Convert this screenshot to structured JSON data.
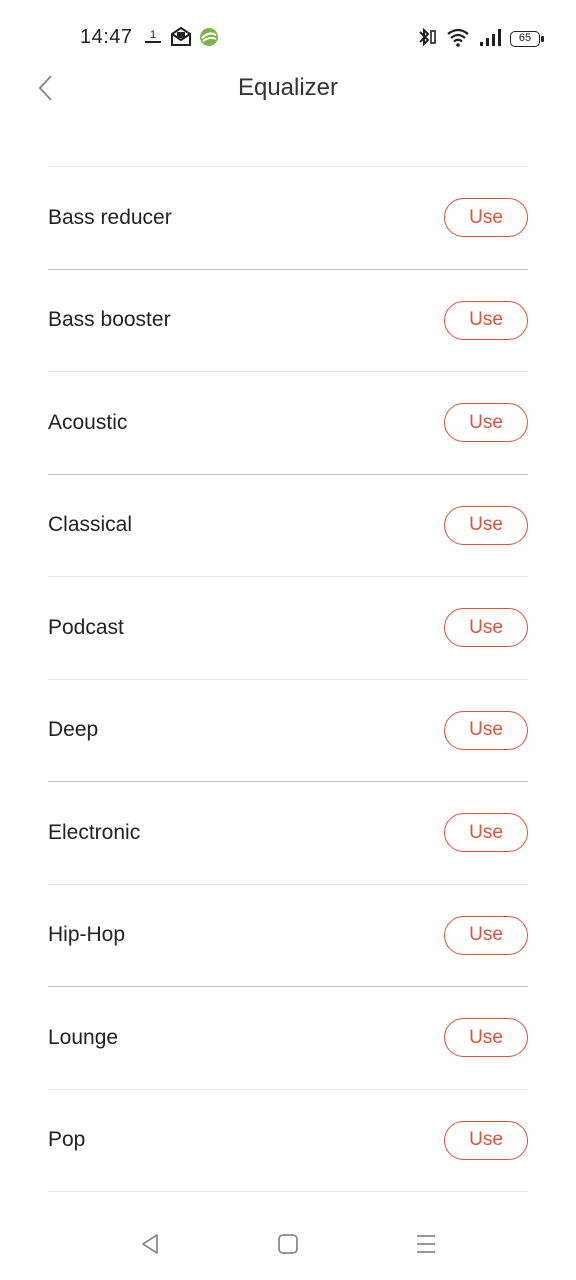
{
  "status_bar": {
    "time": "14:47",
    "battery_level": "65",
    "left_icons": [
      "notification-app-icon",
      "mail-app-icon",
      "globe-app-icon"
    ],
    "right_icons": [
      "bluetooth-icon",
      "wifi-icon",
      "signal-icon",
      "battery-icon"
    ]
  },
  "header": {
    "title": "Equalizer",
    "back_icon": "chevron-left-icon"
  },
  "presets": [
    {
      "name": "Bass reducer",
      "button": "Use"
    },
    {
      "name": "Bass booster",
      "button": "Use"
    },
    {
      "name": "Acoustic",
      "button": "Use"
    },
    {
      "name": "Classical",
      "button": "Use"
    },
    {
      "name": "Podcast",
      "button": "Use"
    },
    {
      "name": "Deep",
      "button": "Use"
    },
    {
      "name": "Electronic",
      "button": "Use"
    },
    {
      "name": "Hip-Hop",
      "button": "Use"
    },
    {
      "name": "Lounge",
      "button": "Use"
    },
    {
      "name": "Pop",
      "button": "Use"
    }
  ],
  "colors": {
    "accent": "#d9533e",
    "text": "#222222",
    "divider": "#e6e6e6"
  },
  "nav_bar": {
    "icons": [
      "back-triangle-icon",
      "home-square-icon",
      "menu-lines-icon"
    ]
  }
}
